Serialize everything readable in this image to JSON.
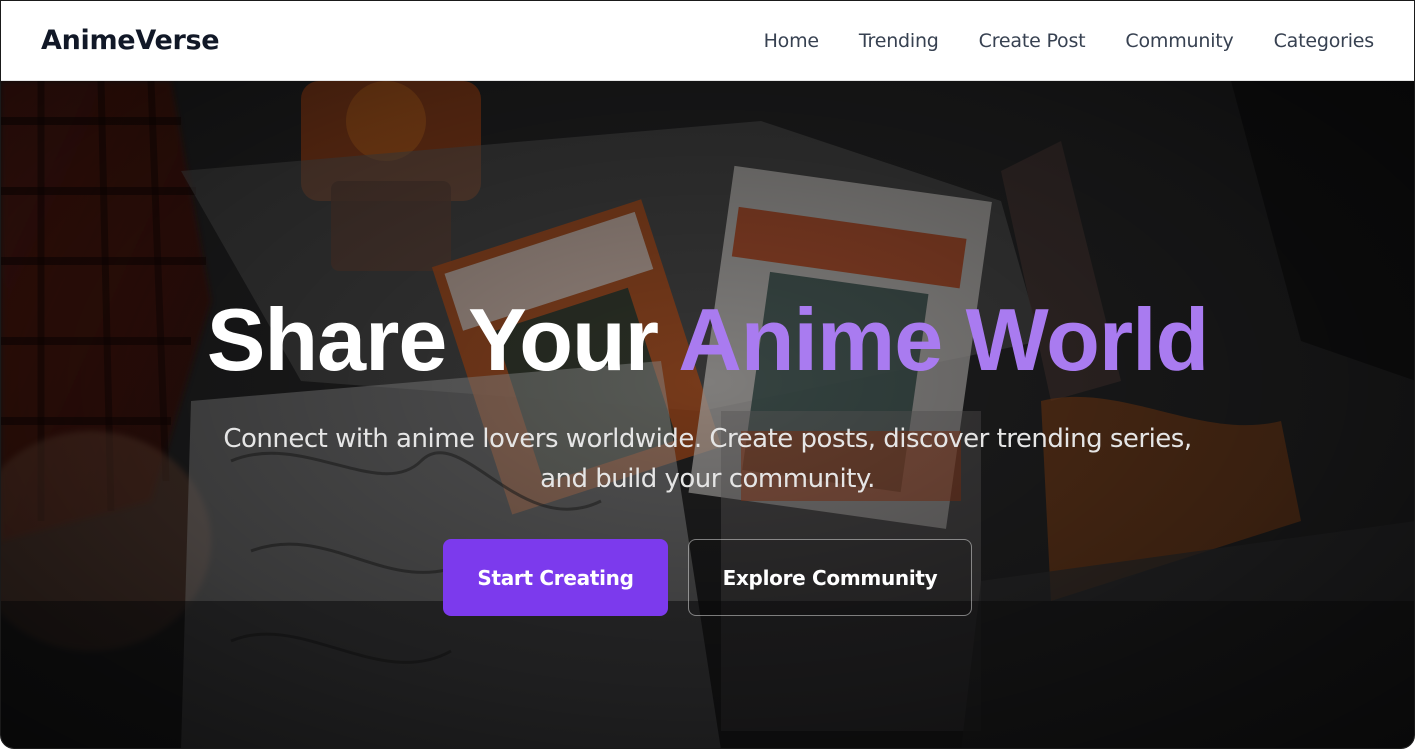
{
  "header": {
    "brand": "AnimeVerse",
    "nav": [
      {
        "label": "Home"
      },
      {
        "label": "Trending"
      },
      {
        "label": "Create Post"
      },
      {
        "label": "Community"
      },
      {
        "label": "Categories"
      }
    ]
  },
  "hero": {
    "headline_main": "Share Your ",
    "headline_accent": "Anime World",
    "subtitle": "Connect with anime lovers worldwide. Create posts, discover trending series, and build your community.",
    "primary_button": "Start Creating",
    "secondary_button": "Explore Community"
  },
  "colors": {
    "accent": "#a97bf0",
    "primary_button": "#7c3aed",
    "brand_text": "#111827"
  }
}
